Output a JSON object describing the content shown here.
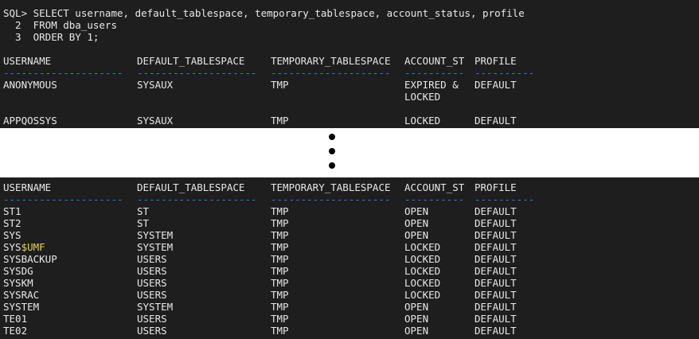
{
  "query": {
    "line1": "SQL> SELECT username, default_tablespace, temporary_tablespace, account_status, profile",
    "line2": "  2  FROM dba_users",
    "line3": "  3  ORDER BY 1;"
  },
  "headers": [
    "USERNAME",
    "DEFAULT_TABLESPACE",
    "TEMPORARY_TABLESPACE",
    "ACCOUNT_ST",
    "PROFILE"
  ],
  "separators": [
    "--------------------",
    "--------------------",
    "--------------------",
    "----------",
    "----------"
  ],
  "top_rows": [
    [
      "ANONYMOUS",
      "SYSAUX",
      "TMP",
      "EXPIRED &",
      "DEFAULT"
    ],
    [
      "",
      "",
      "",
      "LOCKED",
      ""
    ],
    [
      "APPQOSSYS",
      "SYSAUX",
      "TMP",
      "LOCKED",
      "DEFAULT"
    ]
  ],
  "bottom_rows": [
    [
      "ST1",
      "ST",
      "TMP",
      "OPEN",
      "DEFAULT"
    ],
    [
      "ST2",
      "ST",
      "TMP",
      "OPEN",
      "DEFAULT"
    ],
    [
      "SYS",
      "SYSTEM",
      "TMP",
      "OPEN",
      "DEFAULT"
    ],
    [
      "SYS",
      "SYSTEM",
      "TMP",
      "LOCKED",
      "DEFAULT"
    ],
    [
      "SYSBACKUP",
      "USERS",
      "TMP",
      "LOCKED",
      "DEFAULT"
    ],
    [
      "SYSDG",
      "USERS",
      "TMP",
      "LOCKED",
      "DEFAULT"
    ],
    [
      "SYSKM",
      "USERS",
      "TMP",
      "LOCKED",
      "DEFAULT"
    ],
    [
      "SYSRAC",
      "USERS",
      "TMP",
      "LOCKED",
      "DEFAULT"
    ],
    [
      "SYSTEM",
      "SYSTEM",
      "TMP",
      "OPEN",
      "DEFAULT"
    ],
    [
      "TE01",
      "USERS",
      "TMP",
      "OPEN",
      "DEFAULT"
    ],
    [
      "TE02",
      "USERS",
      "TMP",
      "OPEN",
      "DEFAULT"
    ]
  ],
  "highlight_suffix": "$UMF",
  "colors": {
    "background": "#1e1e1e",
    "text": "#e8e8e8",
    "separator": "#3a7bd5",
    "highlight": "#e6d35a"
  }
}
